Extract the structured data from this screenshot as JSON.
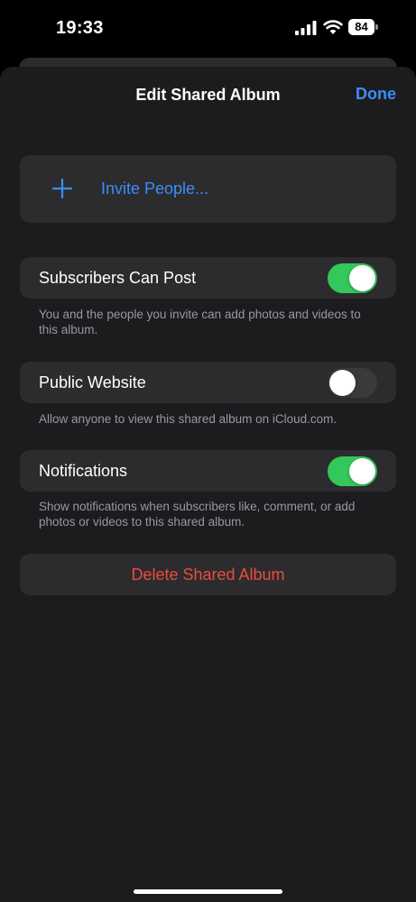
{
  "status_bar": {
    "time": "19:33",
    "battery_level": "84",
    "icons": [
      "signal-icon",
      "wifi-icon",
      "battery-icon"
    ]
  },
  "sheet": {
    "title": "Edit Shared Album",
    "done_label": "Done"
  },
  "invite": {
    "icon": "plus-icon",
    "label": "Invite People..."
  },
  "settings": [
    {
      "label": "Subscribers Can Post",
      "enabled": true,
      "footnote": "You and the people you invite can add photos and videos to this album."
    },
    {
      "label": "Public Website",
      "enabled": false,
      "footnote": "Allow anyone to view this shared album on iCloud.com."
    },
    {
      "label": "Notifications",
      "enabled": true,
      "footnote": "Show notifications when subscribers like, comment, or add photos or videos to this shared album."
    }
  ],
  "delete_label": "Delete Shared Album",
  "colors": {
    "accent": "#3a8ef6",
    "toggle_on": "#34c759",
    "destructive": "#eb4b3f",
    "sheet_background": "#1c1c1e",
    "group_background": "#2c2c2e"
  }
}
